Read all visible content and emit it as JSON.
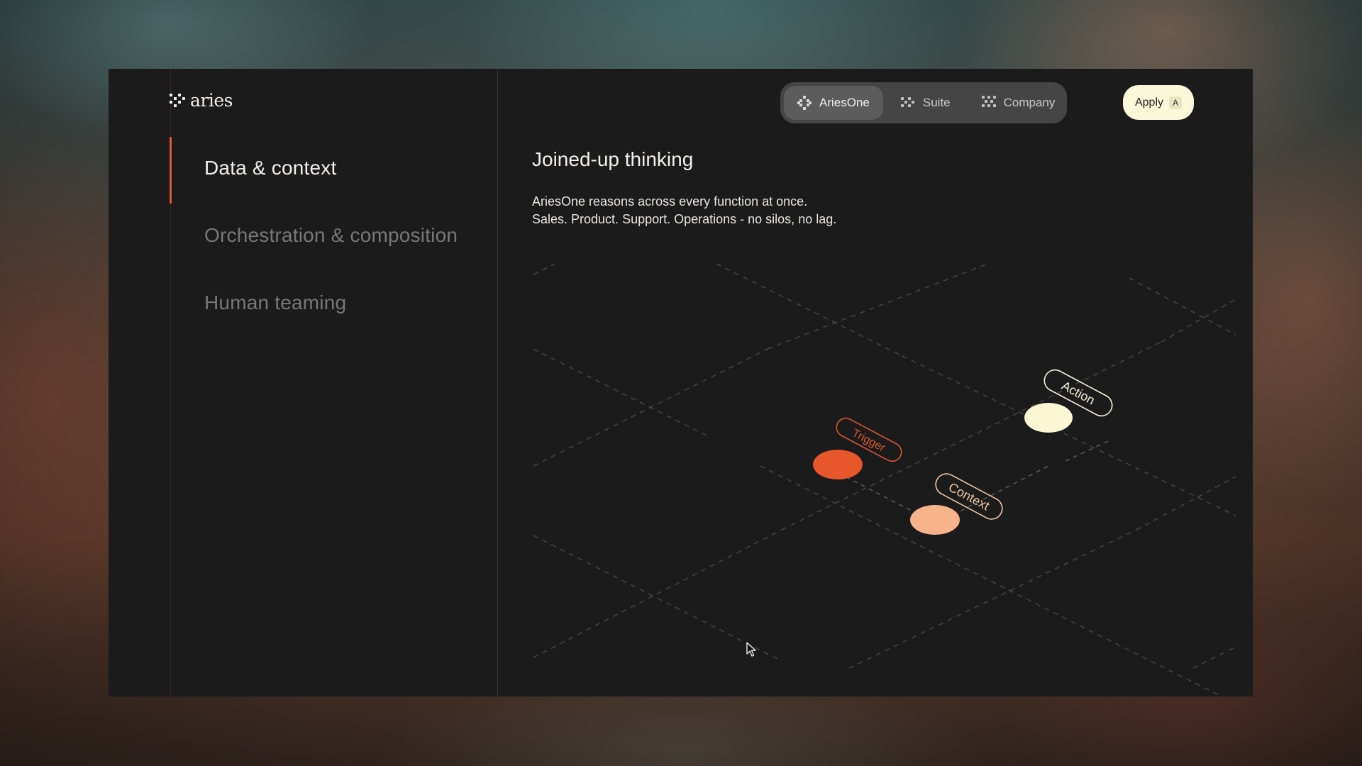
{
  "brand": {
    "name": "aries"
  },
  "sidebar": {
    "items": [
      {
        "label": "Data & context",
        "active": true
      },
      {
        "label": "Orchestration & composition",
        "active": false
      },
      {
        "label": "Human teaming",
        "active": false
      }
    ]
  },
  "topnav": {
    "tabs": [
      {
        "label": "AriesOne",
        "icon": "ariesone-icon",
        "active": true
      },
      {
        "label": "Suite",
        "icon": "suite-icon",
        "active": false
      },
      {
        "label": "Company",
        "icon": "company-icon",
        "active": false
      }
    ],
    "apply": {
      "label": "Apply",
      "shortcut": "A"
    }
  },
  "main": {
    "heading": "Joined-up thinking",
    "description_lines": [
      "AriesOne reasons across every function at once.",
      "Sales. Product. Support. Operations - no silos, no lag."
    ]
  },
  "diagram": {
    "nodes": [
      {
        "label": "Trigger",
        "color": "#e8572c"
      },
      {
        "label": "Context",
        "color": "#f6b38c"
      },
      {
        "label": "Action",
        "color": "#fbf6d3"
      }
    ]
  },
  "colors": {
    "accent": "#e2582f",
    "apply_bg": "#fbf8d9",
    "panel_bg": "#1b1b1b"
  }
}
